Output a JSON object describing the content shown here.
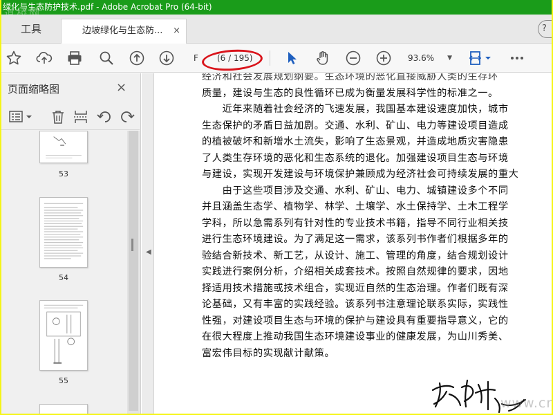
{
  "window": {
    "title": "绿化与生态防护技术.pdf - Adobe Acrobat Pro (64-bit)",
    "watermark_top": "道桥网"
  },
  "tabs": {
    "tools_label": "工具",
    "document_label": "边坡绿化与生态防...",
    "close_label": "×",
    "help_label": "?"
  },
  "toolbar": {
    "page_prefix": "F",
    "page_count": "(6 / 195)",
    "zoom_value": "93.6%",
    "icons": [
      "star-icon",
      "upload-icon",
      "print-icon",
      "zoom-search-icon",
      "page-up-icon",
      "page-down-icon",
      "select-arrow-icon",
      "hand-icon",
      "zoom-out-icon",
      "zoom-in-icon",
      "fit-page-icon",
      "more-icon"
    ],
    "accent_color": "#1f5fbf"
  },
  "sidebar": {
    "title": "页面缩略图",
    "close_label": "×",
    "thumbnails": [
      {
        "label": "53"
      },
      {
        "label": "54"
      },
      {
        "label": "55"
      }
    ]
  },
  "document": {
    "lines": [
      "经济和社会发展规划纲要。生态环境的恶化直接威胁人类的生存环",
      "质量，建设与生态的良性循环已成为衡量发展科学性的标准之一。",
      "　　近年来随着社会经济的飞速发展，我国基本建设速度加快，城市",
      "生态保护的矛盾日益加剧。交通、水利、矿山、电力等建设项目造成",
      "的植被破坏和新增水土流失，影响了生态景观，并造成地质灾害隐患",
      "了人类生存环境的恶化和生态系统的退化。加强建设项目生态与环境",
      "与建设，实现开发建设与环境保护兼顾成为经济社会可持续发展的重大",
      "　　由于这些项目涉及交通、水利、矿山、电力、城镇建设多个不同",
      "并且涵盖生态学、植物学、林学、土壤学、水土保持学、土木工程学",
      "学科，所以急需系列有针对性的专业技术书籍，指导不同行业相关技",
      "进行生态环境建设。为了满足这一需求，该系列书作者们根据多年的",
      "验结合新技术、新工艺，从设计、施工、管理的角度，结合规划设计",
      "实践进行案例分析，介绍相关成套技术。按照自然规律的要求，因地",
      "择适用技术措施或技术组合，实现近自然的生态治理。作者们既有深",
      "论基础，又有丰富的实践经验。该系列书注意理论联系实际，实践性",
      "性强，对建设项目生态与环境的保护与建设具有重要指导意义，它的",
      "在很大程度上推动我国生态环境建设事业的健康发展，为山川秀美、",
      "富宏伟目标的实现献计献策。"
    ],
    "watermark_bottom": "www.cndao.com"
  }
}
